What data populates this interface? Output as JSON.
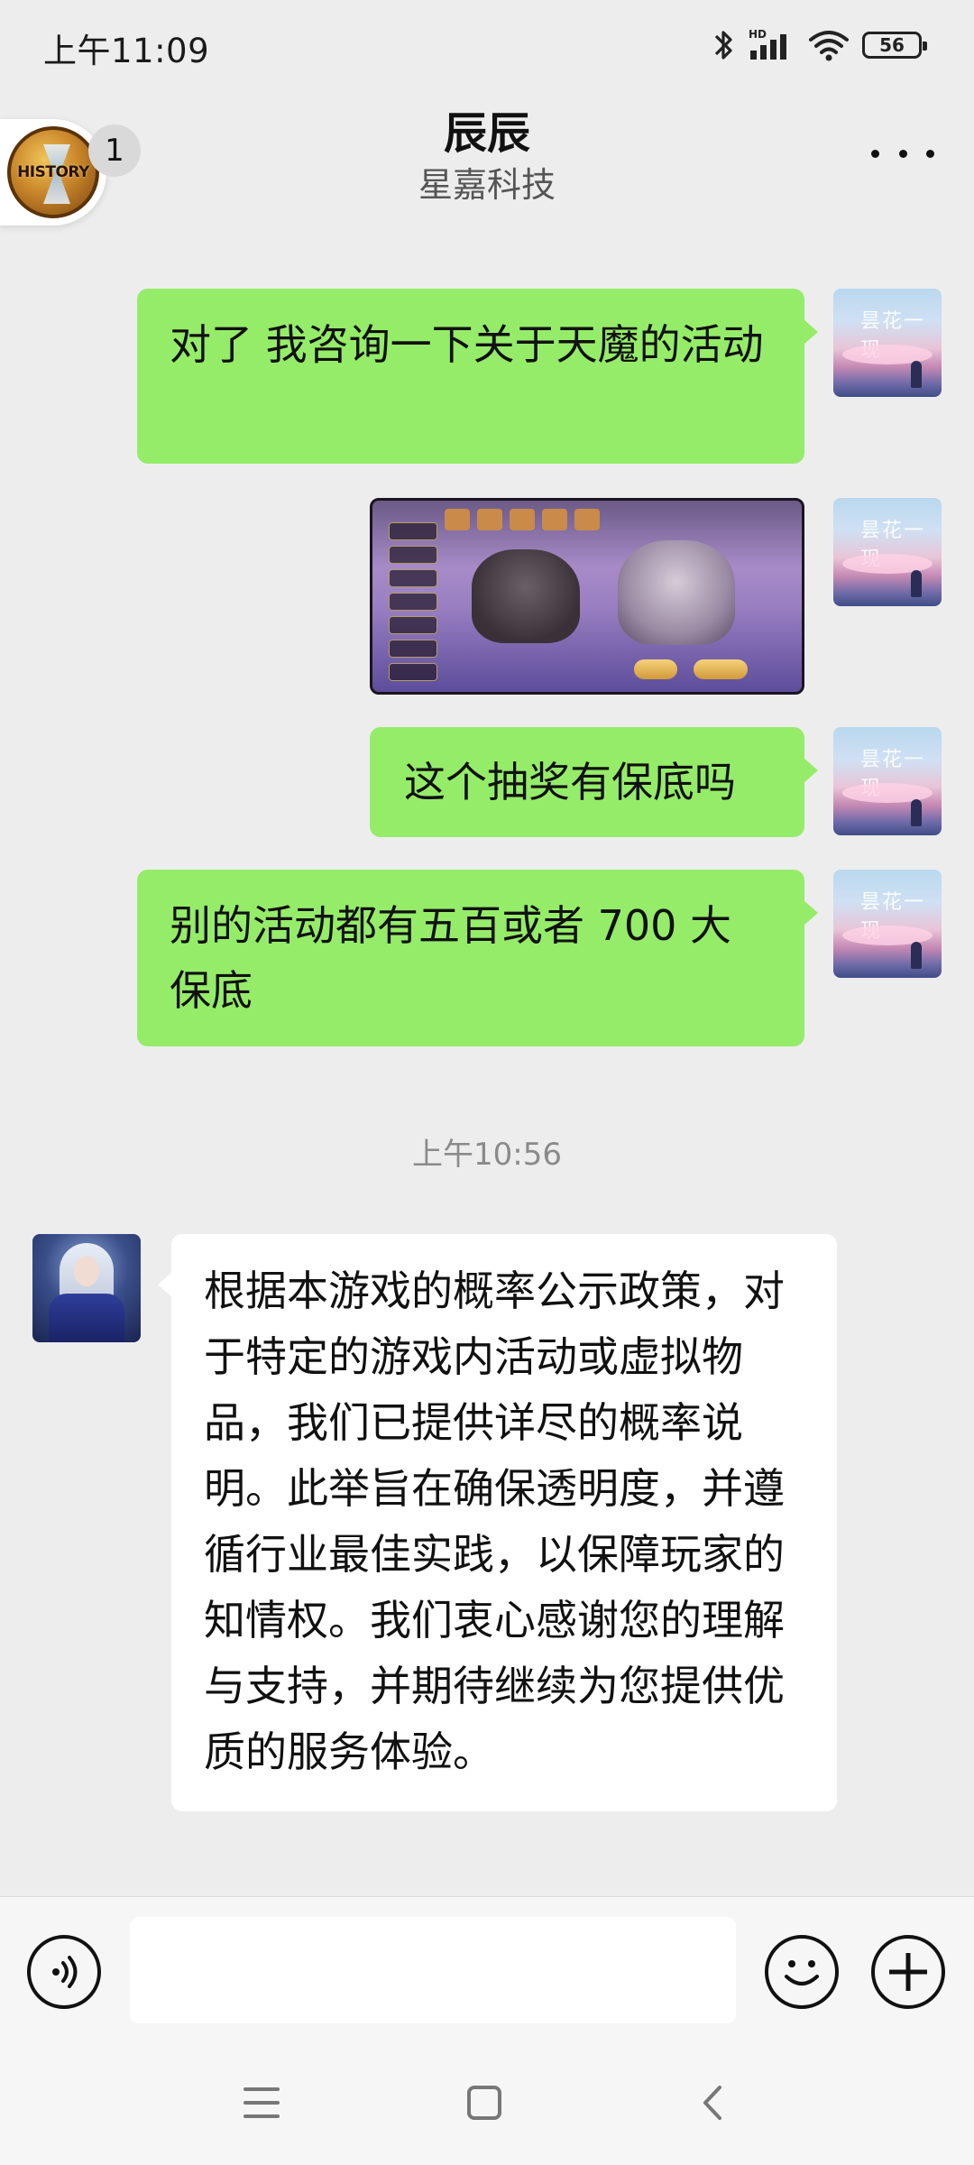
{
  "status_bar": {
    "time": "上午11:09",
    "network": "HD",
    "battery": "56"
  },
  "header": {
    "history_badge": "HISTORY",
    "unread_count": "1",
    "title": "辰辰",
    "subtitle": "星嘉科技"
  },
  "avatars": {
    "me_signature": "昙花一现"
  },
  "messages": [
    {
      "sender": "me",
      "type": "text",
      "text": "对了 我咨询一下关于天魔的活动"
    },
    {
      "sender": "me",
      "type": "image"
    },
    {
      "sender": "me",
      "type": "text",
      "text": "这个抽奖有保底吗"
    },
    {
      "sender": "me",
      "type": "text",
      "text": "别的活动都有五百或者 700 大保底"
    },
    {
      "sender": "them",
      "type": "text",
      "text": "根据本游戏的概率公示政策，对于特定的游戏内活动或虚拟物品，我们已提供详尽的概率说明。此举旨在确保透明度，并遵循行业最佳实践，以保障玩家的知情权。我们衷心感谢您的理解与支持，并期待继续为您提供优质的服务体验。"
    }
  ],
  "timestamp": "上午10:56",
  "input": {
    "value": "",
    "placeholder": ""
  },
  "colors": {
    "my_bubble": "#95ec69",
    "their_bubble": "#ffffff",
    "background": "#ededed"
  },
  "icons": {
    "voice": "voice-icon",
    "emoji": "emoji-icon",
    "plus": "plus-icon",
    "more": "more-icon",
    "nav_menu": "menu-icon",
    "nav_home": "home-icon",
    "nav_back": "back-icon"
  }
}
